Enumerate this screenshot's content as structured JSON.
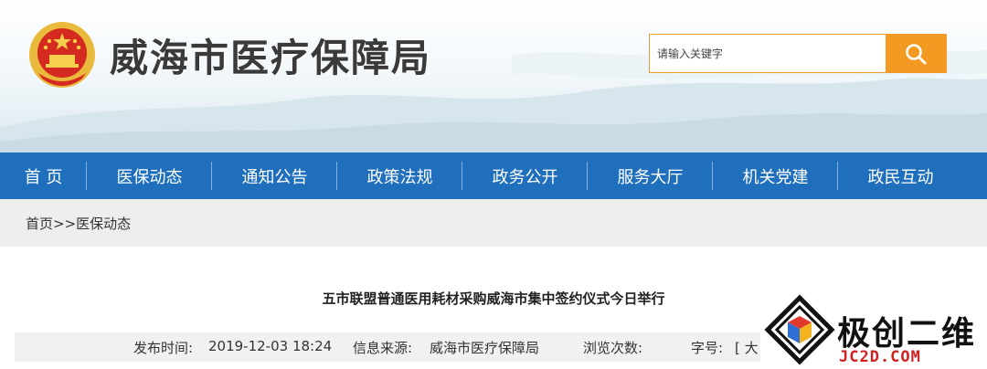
{
  "header": {
    "title": "威海市医疗保障局",
    "emblem_icon": "national-emblem-icon"
  },
  "search": {
    "placeholder": "请输入关键字",
    "button_icon": "search-icon"
  },
  "nav": {
    "items": [
      "首 页",
      "医保动态",
      "通知公告",
      "政策法规",
      "政务公开",
      "服务大厅",
      "机关党建",
      "政民互动"
    ]
  },
  "breadcrumb": {
    "home": "首页",
    "separator": ">>",
    "current": "医保动态"
  },
  "article": {
    "title": "五市联盟普通医用耗材采购威海市集中签约仪式今日举行",
    "publish_label": "发布时间:",
    "publish_value": "2019-12-03 18:24",
    "source_label": "信息来源:",
    "source_value": "威海市医疗保障局",
    "views_label": "浏览次数:",
    "font_size_label": "字号:",
    "font_size_value": "[ 大"
  },
  "watermark": {
    "text": "极创二维",
    "domain": "JC2D.COM"
  },
  "colors": {
    "nav_bg": "#1f6fbd",
    "search_accent": "#f39a23",
    "crumb_bg": "#eeeeee"
  }
}
